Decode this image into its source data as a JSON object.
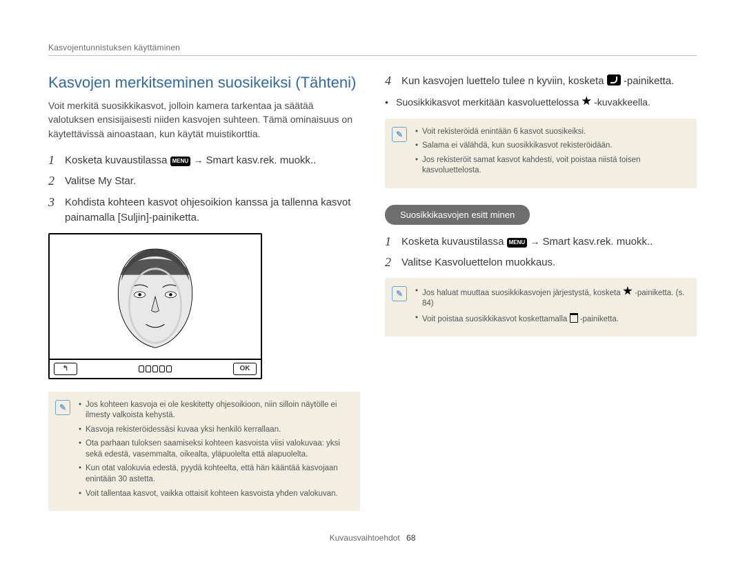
{
  "header": {
    "breadcrumb": "Kasvojentunnistuksen käyttäminen"
  },
  "left": {
    "title": "Kasvojen merkitseminen suosikeiksi (Tähteni)",
    "intro": "Voit merkitä suosikkikasvot, jolloin kamera tarkentaa ja säätää valotuksen ensisijaisesti niiden kasvojen suhteen. Tämä ominaisuus on käytettävissä ainoastaan, kun käytät muistikorttia.",
    "steps": {
      "s1a": "Kosketa kuvaustilassa",
      "s1b": "Smart kasv.rek. muokk..",
      "menu": "MENU",
      "arrow": "→",
      "s2": "Valitse My Star.",
      "s3": "Kohdista kohteen kasvot ohjesoikion kanssa ja tallenna kasvot painamalla [Suljin]-painiketta."
    },
    "cam": {
      "back": "↰",
      "ok": "OK"
    },
    "note": {
      "n1": "Jos kohteen kasvoja ei ole keskitetty ohjesoikioon, niin silloin näytölle ei ilmesty valkoista kehystä.",
      "n2": "Kasvoja rekisteröidessäsi kuvaa yksi henkilö kerrallaan.",
      "n3": "Ota parhaan tuloksen saamiseksi kohteen kasvoista viisi valokuvaa: yksi sekä edestä, vasemmalta, oikealta, yläpuolelta että alapuolelta.",
      "n4": "Kun otat valokuvia edestä, pyydä kohteelta, että hän kääntää kasvojaan enintään 30 astetta.",
      "n5": "Voit tallentaa kasvot, vaikka ottaisit kohteen kasvoista yhden valokuvan."
    }
  },
  "right": {
    "steps": {
      "s4a": "Kun kasvojen luettelo tulee n kyviin, kosketa",
      "s4b": "-painiketta.",
      "bullet": "Suosikkikasvot merkitään kasvoluettelossa",
      "bullet_tail": "-kuvakkeella."
    },
    "note1": {
      "n1": "Voit rekisteröidä enintään 6 kasvot suosikeiksi.",
      "n2": "Salama ei välähdä, kun suosikkikasvot rekisteröidään.",
      "n3": "Jos rekisteröit samat kasvot kahdesti, voit poistaa niistä toisen kasvoluettelosta."
    },
    "subhead": "Suosikkikasvojen esitt minen",
    "steps2": {
      "s1a": "Kosketa kuvaustilassa",
      "s1b": "Smart kasv.rek. muokk..",
      "menu": "MENU",
      "arrow": "→",
      "s2": "Valitse Kasvoluettelon muokkaus."
    },
    "note2": {
      "n1a": "Jos haluat muuttaa suosikkikasvojen järjestystä, kosketa",
      "n1b": "-painiketta. (s. 84)",
      "n2a": "Voit poistaa suosikkikasvot koskettamalla",
      "n2b": "-painiketta."
    }
  },
  "footer": {
    "section": "Kuvausvaihtoehdot",
    "page": "68"
  }
}
